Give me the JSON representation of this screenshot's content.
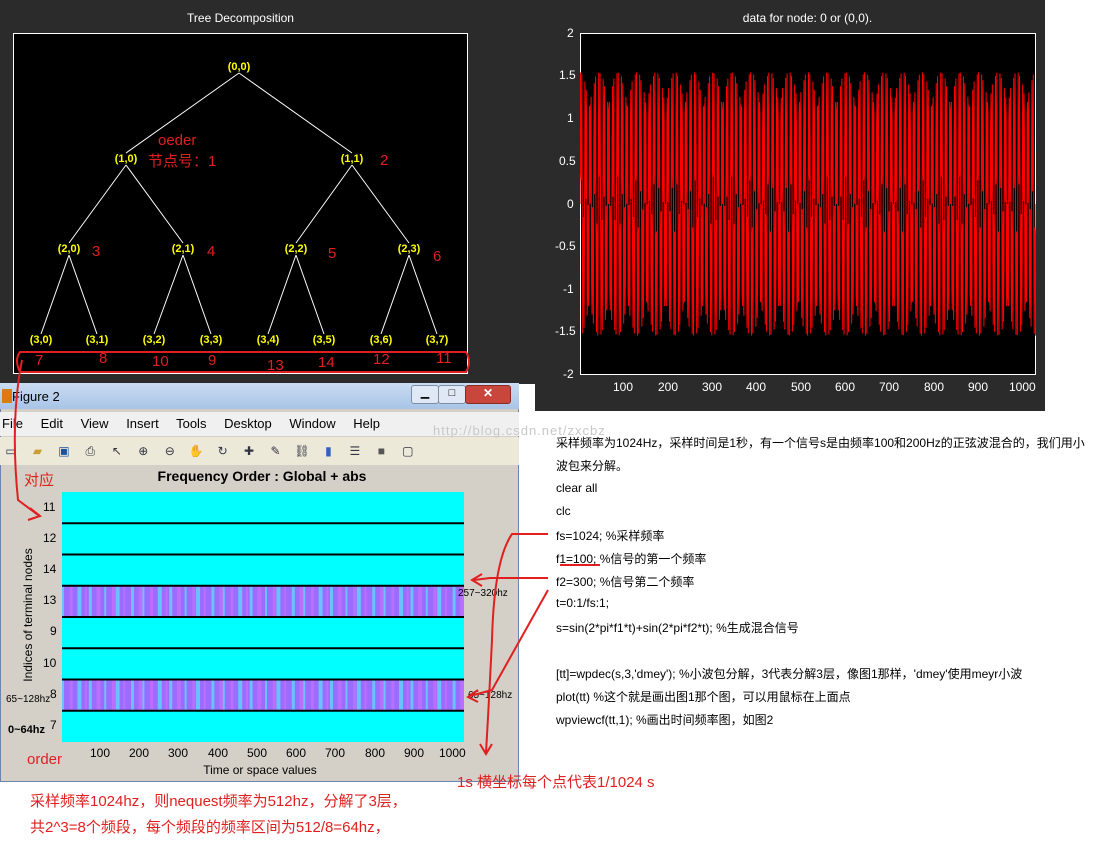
{
  "tree_figure": {
    "title": "Tree Decomposition",
    "nodes": [
      "(0,0)",
      "(1,0)",
      "(1,1)",
      "(2,0)",
      "(2,1)",
      "(2,2)",
      "(2,3)",
      "(3,0)",
      "(3,1)",
      "(3,2)",
      "(3,3)",
      "(3,4)",
      "(3,5)",
      "(3,6)",
      "(3,7)"
    ]
  },
  "annotations": {
    "oeder": "oeder",
    "node_num": "节点号：1",
    "n2": "2",
    "n3": "3",
    "n4": "4",
    "n5": "5",
    "n6": "6",
    "bottom": [
      "7",
      "8",
      "10",
      "9",
      "13",
      "14",
      "12",
      "11"
    ],
    "duiying": "对应",
    "order": "order",
    "label_257": "257~320hz",
    "label_65r": "65~128hz",
    "label_65l": "65~128hz",
    "label_0": "0~64hz",
    "axis_note": "1s  横坐标每个点代表1/1024 s",
    "bottom_note1": "采样频率1024hz，则nequest频率为512hz，分解了3层，",
    "bottom_note2": "共2^3=8个频段，每个频段的频率区间为512/8=64hz，",
    "watermark": "http://blog.csdn.net/zxcbz"
  },
  "signal_figure": {
    "title": "data for node: 0 or (0,0).",
    "yticks": [
      "2",
      "1.5",
      "1",
      "0.5",
      "0",
      "-0.5",
      "-1",
      "-1.5",
      "-2"
    ],
    "xticks": [
      "100",
      "200",
      "300",
      "400",
      "500",
      "600",
      "700",
      "800",
      "900",
      "1000"
    ],
    "line_color": "#ff0000"
  },
  "figure2": {
    "title": "Figure 2",
    "menu": [
      "File",
      "Edit",
      "View",
      "Insert",
      "Tools",
      "Desktop",
      "Window",
      "Help"
    ],
    "plot_title": "Frequency Order : Global + abs",
    "ylabel": "Indices of terminal nodes",
    "xlabel": "Time or space values",
    "rows": [
      "11",
      "12",
      "14",
      "13",
      "9",
      "10",
      "8",
      "7"
    ],
    "highlight_rows": [
      "13",
      "8"
    ],
    "xticks": [
      "100",
      "200",
      "300",
      "400",
      "500",
      "600",
      "700",
      "800",
      "900",
      "1000"
    ]
  },
  "code_text": [
    "采样频率为1024Hz，采样时间是1秒，有一个信号s是由频率100和200Hz的正弦波混合的，我们用小",
    "波包来分解。",
    "clear all",
    "clc",
    "fs=1024;  %采样频率",
    "f1=100;    %信号的第一个频率",
    "f2=300;    %信号第二个频率",
    "t=0:1/fs:1;",
    "s=sin(2*pi*f1*t)+sin(2*pi*f2*t);  %生成混合信号",
    "",
    "[tt]=wpdec(s,3,'dmey');  %小波包分解，3代表分解3层，像图1那样，'dmey'使用meyr小波",
    "plot(tt)                   %这个就是画出图1那个图，可以用鼠标在上面点",
    "wpviewcf(tt,1);           %画出时间频率图，如图2"
  ]
}
